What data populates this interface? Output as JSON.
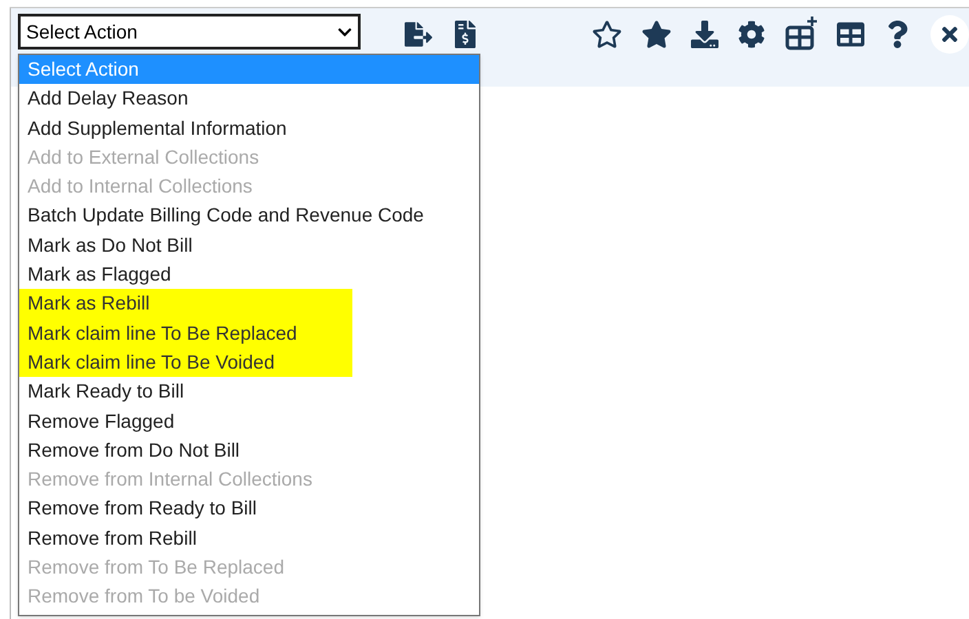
{
  "action_select": {
    "value": "Select Action"
  },
  "options": [
    {
      "label": "Select Action",
      "selected": true,
      "disabled": false,
      "highlighted": false
    },
    {
      "label": "Add Delay Reason",
      "selected": false,
      "disabled": false,
      "highlighted": false
    },
    {
      "label": "Add Supplemental Information",
      "selected": false,
      "disabled": false,
      "highlighted": false
    },
    {
      "label": "Add to External Collections",
      "selected": false,
      "disabled": true,
      "highlighted": false
    },
    {
      "label": "Add to Internal Collections",
      "selected": false,
      "disabled": true,
      "highlighted": false
    },
    {
      "label": "Batch Update Billing Code and Revenue Code",
      "selected": false,
      "disabled": false,
      "highlighted": false
    },
    {
      "label": "Mark as Do Not Bill",
      "selected": false,
      "disabled": false,
      "highlighted": false
    },
    {
      "label": "Mark as Flagged",
      "selected": false,
      "disabled": false,
      "highlighted": false
    },
    {
      "label": "Mark as Rebill",
      "selected": false,
      "disabled": false,
      "highlighted": true
    },
    {
      "label": "Mark claim line To Be Replaced",
      "selected": false,
      "disabled": false,
      "highlighted": true
    },
    {
      "label": "Mark claim line To Be Voided",
      "selected": false,
      "disabled": false,
      "highlighted": true
    },
    {
      "label": "Mark Ready to Bill",
      "selected": false,
      "disabled": false,
      "highlighted": false
    },
    {
      "label": "Remove Flagged",
      "selected": false,
      "disabled": false,
      "highlighted": false
    },
    {
      "label": "Remove from Do Not Bill",
      "selected": false,
      "disabled": false,
      "highlighted": false
    },
    {
      "label": "Remove from Internal Collections",
      "selected": false,
      "disabled": true,
      "highlighted": false
    },
    {
      "label": "Remove from Ready to Bill",
      "selected": false,
      "disabled": false,
      "highlighted": false
    },
    {
      "label": "Remove from Rebill",
      "selected": false,
      "disabled": false,
      "highlighted": false
    },
    {
      "label": "Remove from To Be Replaced",
      "selected": false,
      "disabled": true,
      "highlighted": false
    },
    {
      "label": "Remove from To be Voided",
      "selected": false,
      "disabled": true,
      "highlighted": false
    }
  ],
  "toolbar": [
    {
      "kind": "export"
    },
    {
      "kind": "invoice"
    },
    {
      "kind": "star-outline"
    },
    {
      "kind": "star"
    },
    {
      "kind": "download"
    },
    {
      "kind": "settings"
    },
    {
      "kind": "table-add"
    },
    {
      "kind": "table"
    },
    {
      "kind": "help"
    },
    {
      "kind": "close"
    }
  ]
}
